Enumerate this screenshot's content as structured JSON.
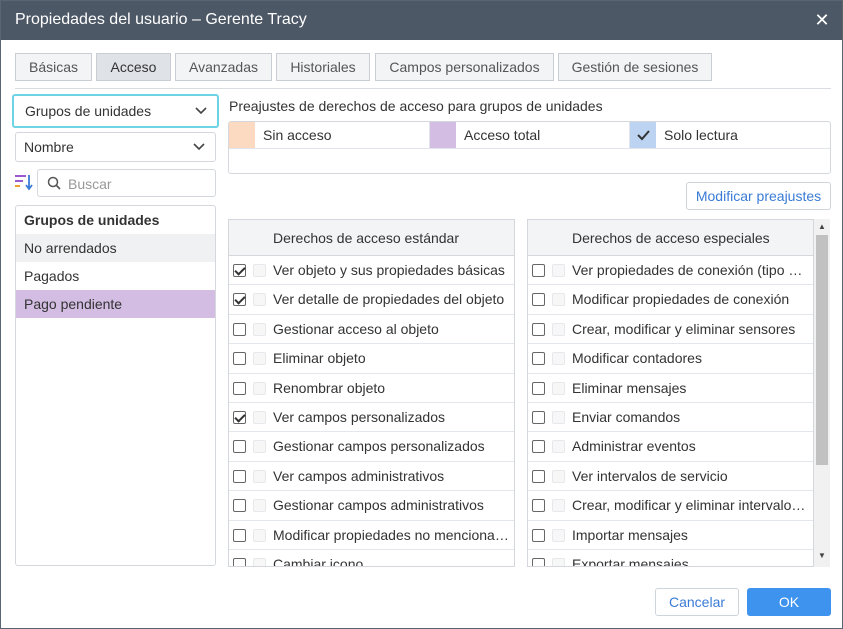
{
  "dialog": {
    "title": "Propiedades del usuario – Gerente Tracy",
    "close_symbol": "✕"
  },
  "tabs": [
    {
      "label": "Básicas"
    },
    {
      "label": "Acceso"
    },
    {
      "label": "Avanzadas"
    },
    {
      "label": "Historiales"
    },
    {
      "label": "Campos personalizados"
    },
    {
      "label": "Gestión de sesiones"
    }
  ],
  "left": {
    "type_select": "Grupos de unidades",
    "sort_select": "Nombre",
    "search_placeholder": "Buscar",
    "list_header": "Grupos de unidades",
    "items": [
      {
        "label": "No arrendados"
      },
      {
        "label": "Pagados"
      },
      {
        "label": "Pago pendiente"
      }
    ]
  },
  "presets": {
    "title": "Preajustes de derechos de acceso para grupos de unidades",
    "items": [
      {
        "label": "Sin acceso",
        "color": "#fcd9c1"
      },
      {
        "label": "Acceso total",
        "color": "#d3bde3"
      },
      {
        "label": "Solo lectura",
        "color": "#bcd3f2",
        "checked": true
      }
    ],
    "modify_label": "Modificar preajustes"
  },
  "standard": {
    "header": "Derechos de acceso estándar",
    "rows": [
      {
        "label": "Ver objeto y sus propiedades básicas",
        "checked": true
      },
      {
        "label": "Ver detalle de propiedades del objeto",
        "checked": true
      },
      {
        "label": "Gestionar acceso al objeto",
        "checked": false
      },
      {
        "label": "Eliminar objeto",
        "checked": false
      },
      {
        "label": "Renombrar objeto",
        "checked": false
      },
      {
        "label": "Ver campos personalizados",
        "checked": true
      },
      {
        "label": "Gestionar campos personalizados",
        "checked": false
      },
      {
        "label": "Ver campos administrativos",
        "checked": false
      },
      {
        "label": "Gestionar campos administrativos",
        "checked": false
      },
      {
        "label": "Modificar propiedades no mencionadas",
        "checked": false
      },
      {
        "label": "Cambiar icono",
        "checked": false
      }
    ]
  },
  "special": {
    "header": "Derechos de acceso especiales",
    "rows": [
      {
        "label": "Ver propiedades de conexión (tipo de dispositivo)",
        "checked": false
      },
      {
        "label": "Modificar propiedades de conexión",
        "checked": false
      },
      {
        "label": "Crear, modificar y eliminar sensores",
        "checked": false
      },
      {
        "label": "Modificar contadores",
        "checked": false
      },
      {
        "label": "Eliminar mensajes",
        "checked": false
      },
      {
        "label": "Enviar comandos",
        "checked": false
      },
      {
        "label": "Administrar eventos",
        "checked": false
      },
      {
        "label": "Ver intervalos de servicio",
        "checked": false
      },
      {
        "label": "Crear, modificar y eliminar intervalos de servicio",
        "checked": false
      },
      {
        "label": "Importar mensajes",
        "checked": false
      },
      {
        "label": "Exportar mensajes",
        "checked": false
      }
    ]
  },
  "footer": {
    "cancel": "Cancelar",
    "ok": "OK"
  }
}
